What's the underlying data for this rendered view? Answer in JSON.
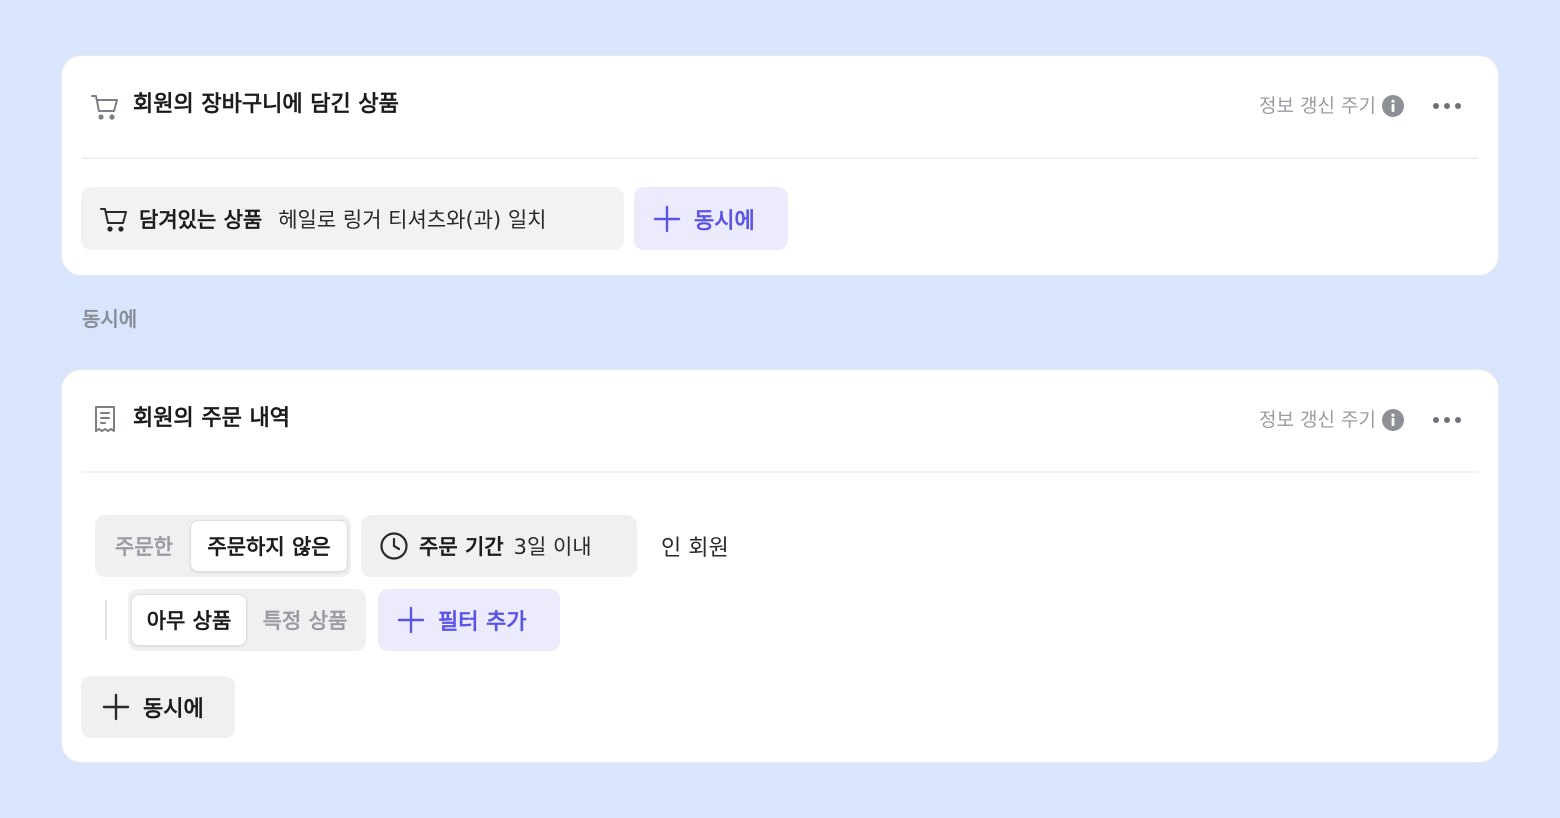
{
  "colors": {
    "background": "#d8e5fd",
    "accent": "#5b55e6",
    "accent_bg": "#ebebfd",
    "chip_bg": "#f2f2f3"
  },
  "card1": {
    "icon": "cart-icon",
    "title": "회원의 장바구니에 담긴 상품",
    "refresh_label": "정보 갱신 주기",
    "filter": {
      "icon": "cart-icon",
      "label": "담겨있는 상품",
      "value": "헤일로 링거 티셔츠와(과) 일치"
    },
    "add_label": "동시에"
  },
  "between_label": "동시에",
  "card2": {
    "icon": "receipt-icon",
    "title": "회원의 주문 내역",
    "refresh_label": "정보 갱신 주기",
    "order_toggle": {
      "options": [
        "주문한",
        "주문하지 않은"
      ],
      "selected": "주문하지 않은"
    },
    "period": {
      "icon": "clock-icon",
      "label": "주문 기간",
      "value": "3일 이내"
    },
    "suffix": "인 회원",
    "product_toggle": {
      "options": [
        "아무 상품",
        "특정 상품"
      ],
      "selected": "아무 상품"
    },
    "add_filter_label": "필터 추가",
    "add_label": "동시에"
  }
}
